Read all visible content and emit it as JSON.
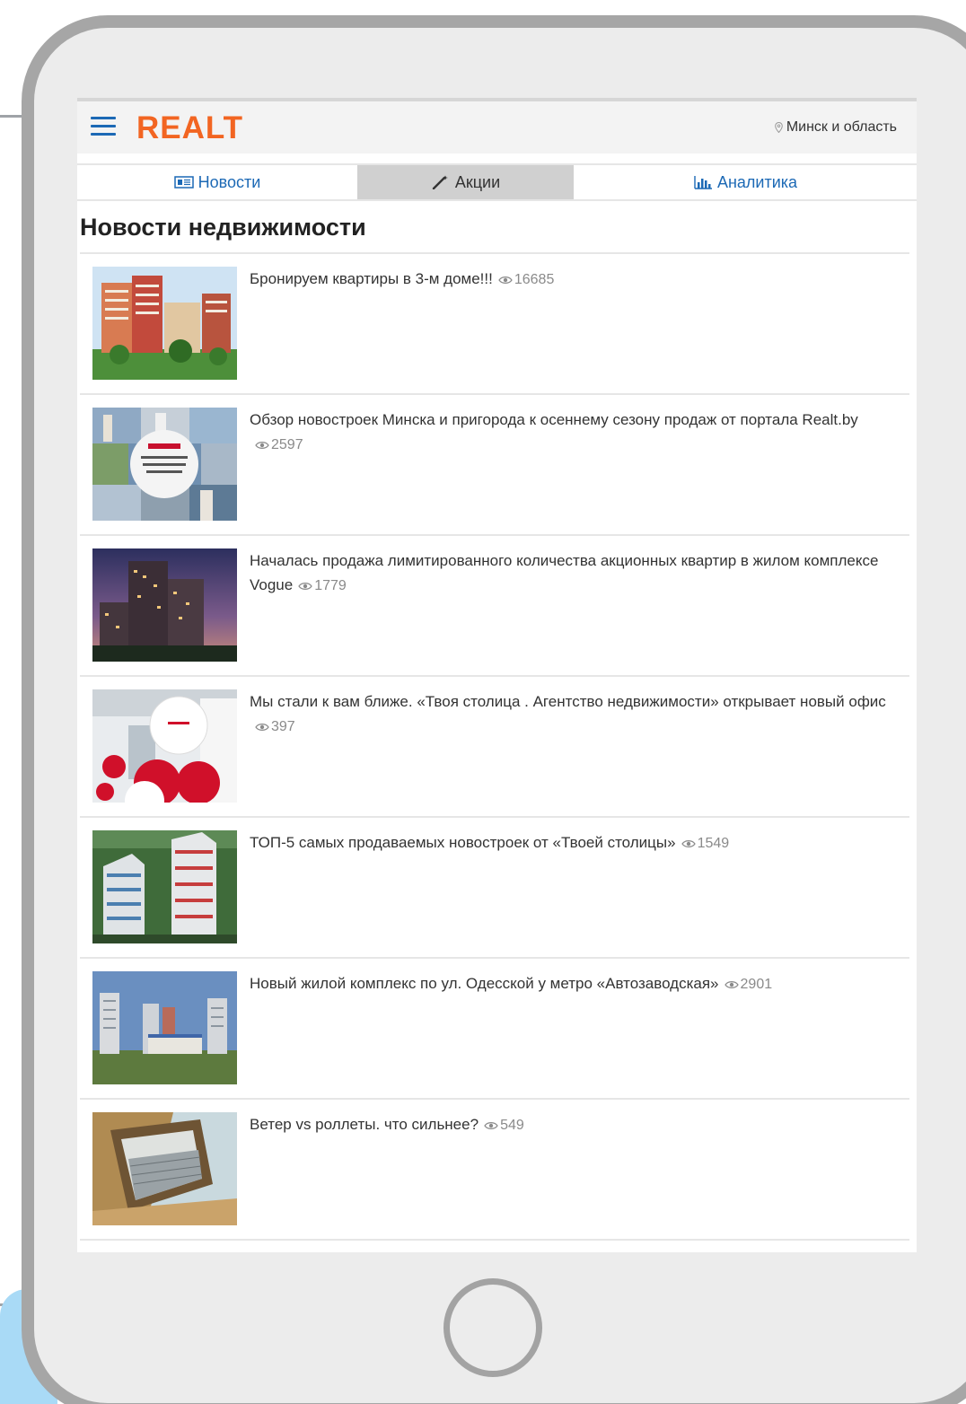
{
  "header": {
    "logo": "REALT",
    "region": "Минск и область",
    "menu_icon": "hamburger-menu-icon",
    "region_icon": "map-pin-icon"
  },
  "tabs": [
    {
      "label": "Новости",
      "icon": "newspaper-icon",
      "active": false
    },
    {
      "label": "Акции",
      "icon": "magic-wand-icon",
      "active": true
    },
    {
      "label": "Аналитика",
      "icon": "bar-chart-icon",
      "active": false
    }
  ],
  "page_title": "Новости недвижимости",
  "news": [
    {
      "title": "Бронируем квартиры в 3-м доме!!!",
      "views": "16685",
      "image": "residential-towers-photo"
    },
    {
      "title": "Обзор новостроек Минска и пригорода к осеннему сезону продаж от портала Realt.by",
      "views": "2597",
      "image": "new-buildings-collage-photo"
    },
    {
      "title": "Началась продажа лимитированного количества акционных квартир в жилом комплексе Vogue",
      "views": "1779",
      "image": "tower-at-dusk-photo"
    },
    {
      "title": "Мы стали к вам ближе. «Твоя столица . Агентство недвижимости» открывает новый офис",
      "views": "397",
      "image": "balloons-office-photo"
    },
    {
      "title": "ТОП-5 самых продаваемых новостроек от «Твоей столицы»",
      "views": "1549",
      "image": "highrise-aerial-photo"
    },
    {
      "title": "Новый жилой комплекс по ул. Одесской у метро «Автозаводская»",
      "views": "2901",
      "image": "residential-complex-photo"
    },
    {
      "title": "Ветер vs роллеты. что сильнее?",
      "views": "549",
      "image": "roller-shutter-window-photo"
    }
  ],
  "colors": {
    "brand": "#f26522",
    "link": "#1c69b5",
    "device_frame": "#a6a6a6",
    "device_body": "#ececec"
  }
}
